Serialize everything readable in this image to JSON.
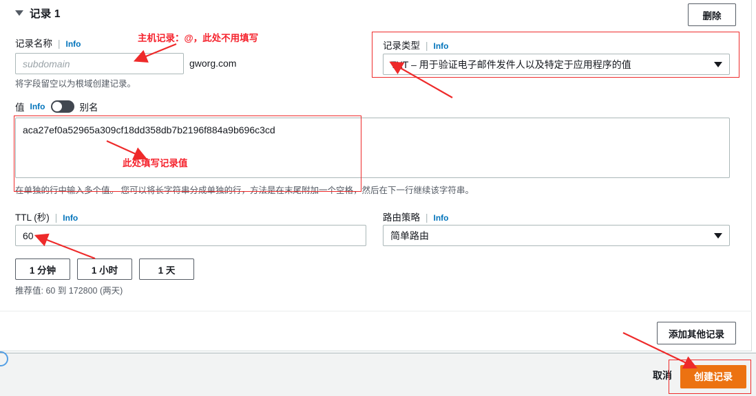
{
  "record": {
    "title": "记录 1",
    "collapse_icon": "caret-down-icon",
    "delete_label": "删除"
  },
  "info_label": "Info",
  "name_field": {
    "label": "记录名称",
    "placeholder": "subdomain",
    "value": "",
    "domain_suffix": "gworg.com",
    "hint": "将字段留空以为根域创建记录。"
  },
  "type_field": {
    "label": "记录类型",
    "selected": "TXT – 用于验证电子邮件发件人以及特定于应用程序的值",
    "caret_icon": "caret-down-icon"
  },
  "value_field": {
    "label": "值",
    "alias_label": "别名",
    "toggle_state": "off",
    "value": "aca27ef0a52965a309cf18dd358db7b2196f884a9b696c3cd",
    "hint": "在单独的行中输入多个值。 您可以将长字符串分成单独的行，方法是在末尾附加一个空格，然后在下一行继续该字符串。"
  },
  "ttl_field": {
    "label": "TTL (秒)",
    "value": "60",
    "presets": [
      "1 分钟",
      "1 小时",
      "1 天"
    ],
    "hint": "推荐值: 60 到 172800 (两天)"
  },
  "routing_field": {
    "label": "路由策略",
    "selected": "简单路由",
    "caret_icon": "caret-down-icon"
  },
  "add_another_label": "添加其他记录",
  "footer": {
    "cancel_label": "取消",
    "create_label": "创建记录",
    "create_color": "#ec7211"
  },
  "annotations": {
    "color": "#f5232d",
    "name_note": "主机记录：@，此处不用填写",
    "value_note": "此处填写记录值"
  }
}
